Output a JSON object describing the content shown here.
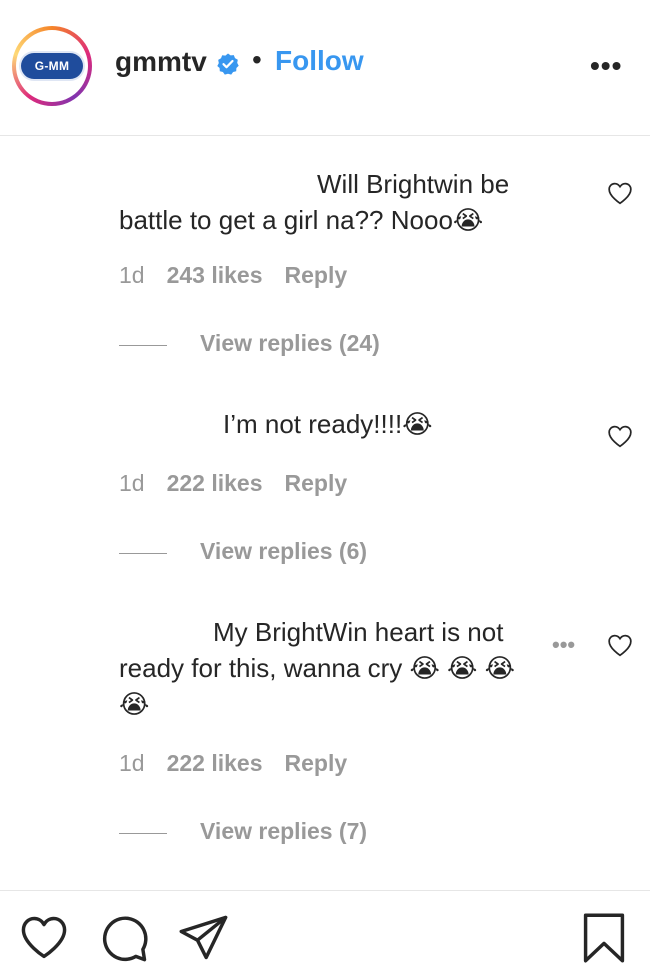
{
  "header": {
    "avatar_text": "G-MM",
    "username": "gmmtv",
    "separator": "•",
    "follow_label": "Follow",
    "more_label": "•••"
  },
  "comments": [
    {
      "text_line1": "Will Brightwin be",
      "text_line2": "battle to get a girl na?? Nooo😭",
      "time": "1d",
      "likes": "243 likes",
      "reply": "Reply",
      "view_replies": "View replies (24)"
    },
    {
      "text_line1": "I’m not ready!!!!😭",
      "time": "1d",
      "likes": "222 likes",
      "reply": "Reply",
      "view_replies": "View replies (6)"
    },
    {
      "text_line1": "My BrightWin heart is not",
      "text_line2": "ready for this, wanna cry 😭 😭 😭",
      "text_line3": "😭",
      "more": "•••",
      "time": "1d",
      "likes": "222 likes",
      "reply": "Reply",
      "view_replies": "View replies (7)"
    }
  ],
  "colors": {
    "link_blue": "#3897f0",
    "muted_gray": "#999999",
    "text": "#262626"
  },
  "icons": [
    "verified-badge-icon",
    "more-icon",
    "heart-icon",
    "comment-icon",
    "share-icon",
    "bookmark-icon"
  ]
}
